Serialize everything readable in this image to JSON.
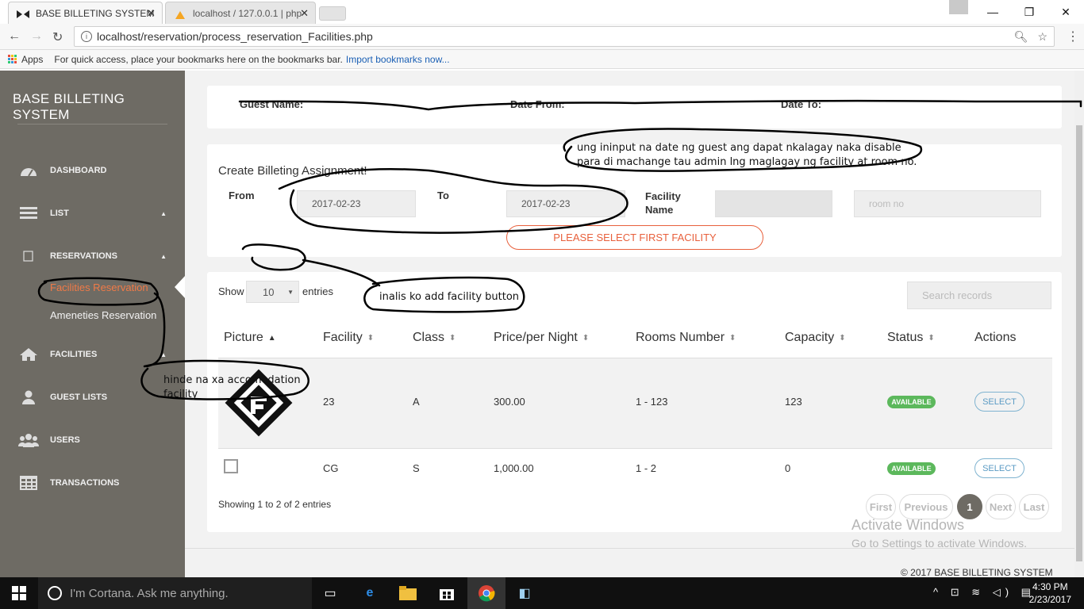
{
  "browser": {
    "active_tab_title": "BASE BILLETING SYSTEM",
    "inactive_tab_title": "localhost / 127.0.0.1 | php",
    "url": "localhost/reservation/process_reservation_Facilities.php",
    "bookmarks_apps": "Apps",
    "bookmarks_hint": "For quick access, place your bookmarks here on the bookmarks bar.",
    "bookmarks_link": "Import bookmarks now..."
  },
  "sidebar": {
    "brand": "BASE BILLETING SYSTEM",
    "items": [
      {
        "label": "DASHBOARD",
        "icon": "dashboard-icon"
      },
      {
        "label": "LIST",
        "icon": "list-icon"
      },
      {
        "label": "RESERVATIONS",
        "icon": "square-icon"
      },
      {
        "label": "FACILITIES",
        "icon": "home-icon"
      },
      {
        "label": "GUEST LISTS",
        "icon": "user-icon"
      },
      {
        "label": "USERS",
        "icon": "users-icon"
      },
      {
        "label": "TRANSACTIONS",
        "icon": "table-icon"
      }
    ],
    "sub_items": [
      "Facilities Reservation",
      "Ameneties Reservation"
    ]
  },
  "guest_bar": {
    "guest_name_label": "Guest Name:",
    "date_from_label": "Date From:",
    "date_to_label": "Date To:"
  },
  "assignment": {
    "title": "Create Billeting Assignment!",
    "from_label": "From",
    "from_value": "2017-02-23",
    "to_label": "To",
    "to_value": "2017-02-23",
    "facility_name_label": "Facility Name",
    "facility_name_value": "",
    "room_placeholder": "room no",
    "select_first_label": "PLEASE SELECT FIRST FACILITY"
  },
  "table": {
    "show_label": "Show",
    "entries_count": "10",
    "entries_label": "entries",
    "search_placeholder": "Search records",
    "columns": [
      "Picture",
      "Facility",
      "Class",
      "Price/per Night",
      "Rooms Number",
      "Capacity",
      "Status",
      "Actions"
    ],
    "rows": [
      {
        "facility": "23",
        "class": "A",
        "price": "300.00",
        "rooms": "1 - 123",
        "capacity": "123",
        "status": "AVAILABLE",
        "action": "SELECT"
      },
      {
        "facility": "CG",
        "class": "S",
        "price": "1,000.00",
        "rooms": "1 - 2",
        "capacity": "0",
        "status": "AVAILABLE",
        "action": "SELECT"
      }
    ],
    "showing": "Showing 1 to 2 of 2 entries",
    "pagination": {
      "first": "First",
      "previous": "Previous",
      "current": "1",
      "next": "Next",
      "last": "Last"
    }
  },
  "annotations": {
    "note1": "ung ininput na date ng guest ang dapat nkalagay naka disable para di machange tau admin lng maglagay ng facility at room no.",
    "note2": "inalis ko add facility button",
    "note3": "hinde na xa accomodation facility"
  },
  "footer": "© 2017 BASE BILLETING SYSTEM",
  "windows_watermark": {
    "line1": "Activate Windows",
    "line2": "Go to Settings to activate Windows."
  },
  "taskbar": {
    "cortana": "I'm Cortana. Ask me anything.",
    "time": "4:30 PM",
    "date": "2/23/2017"
  }
}
